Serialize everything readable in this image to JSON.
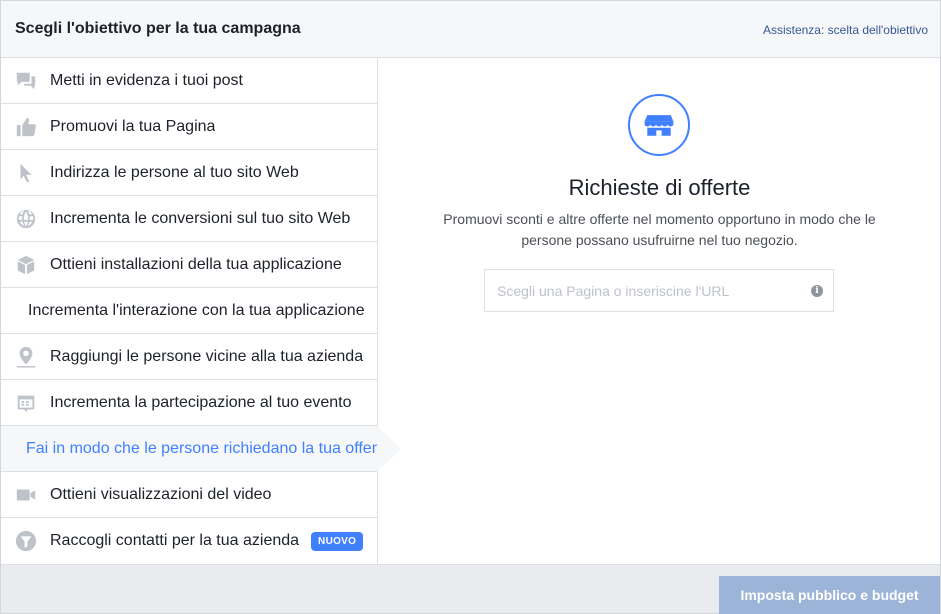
{
  "header": {
    "title": "Scegli l'obiettivo per la tua campagna",
    "help_link": "Assistenza: scelta dell'obiettivo"
  },
  "sidebar": {
    "items": [
      {
        "label": "Metti in evidenza i tuoi post",
        "icon": "speech-bubbles-icon"
      },
      {
        "label": "Promuovi la tua Pagina",
        "icon": "thumbs-up-icon"
      },
      {
        "label": "Indirizza le persone al tuo sito Web",
        "icon": "cursor-icon"
      },
      {
        "label": "Incrementa le conversioni sul tuo sito Web",
        "icon": "globe-icon"
      },
      {
        "label": "Ottieni installazioni della tua applicazione",
        "icon": "box-icon"
      },
      {
        "label": "Incrementa l'interazione con la tua applicazione",
        "icon": ""
      },
      {
        "label": "Raggiungi le persone vicine alla tua azienda",
        "icon": "map-pin-icon"
      },
      {
        "label": "Incrementa la partecipazione al tuo evento",
        "icon": "calendar-icon"
      },
      {
        "label": "Fai in modo che le persone richiedano la tua offer",
        "icon": "",
        "selected": true
      },
      {
        "label": "Ottieni visualizzazioni del video",
        "icon": "video-camera-icon"
      },
      {
        "label": "Raccogli contatti per la tua azienda",
        "icon": "funnel-icon",
        "badge": "NUOVO"
      }
    ]
  },
  "content": {
    "icon": "storefront-icon",
    "title": "Richieste di offerte",
    "description": "Promuovi sconti e altre offerte nel momento opportuno in modo che le persone possano usufruirne nel tuo negozio.",
    "url_input": {
      "placeholder": "Scegli una Pagina o inseriscine l'URL",
      "value": ""
    },
    "info_icon": "info-icon"
  },
  "footer": {
    "primary_button": "Imposta pubblico e budget"
  },
  "colors": {
    "accent": "#4080ff",
    "link": "#365899",
    "icon_gray": "#bec2c9",
    "disabled_button": "#9cb4d8"
  }
}
